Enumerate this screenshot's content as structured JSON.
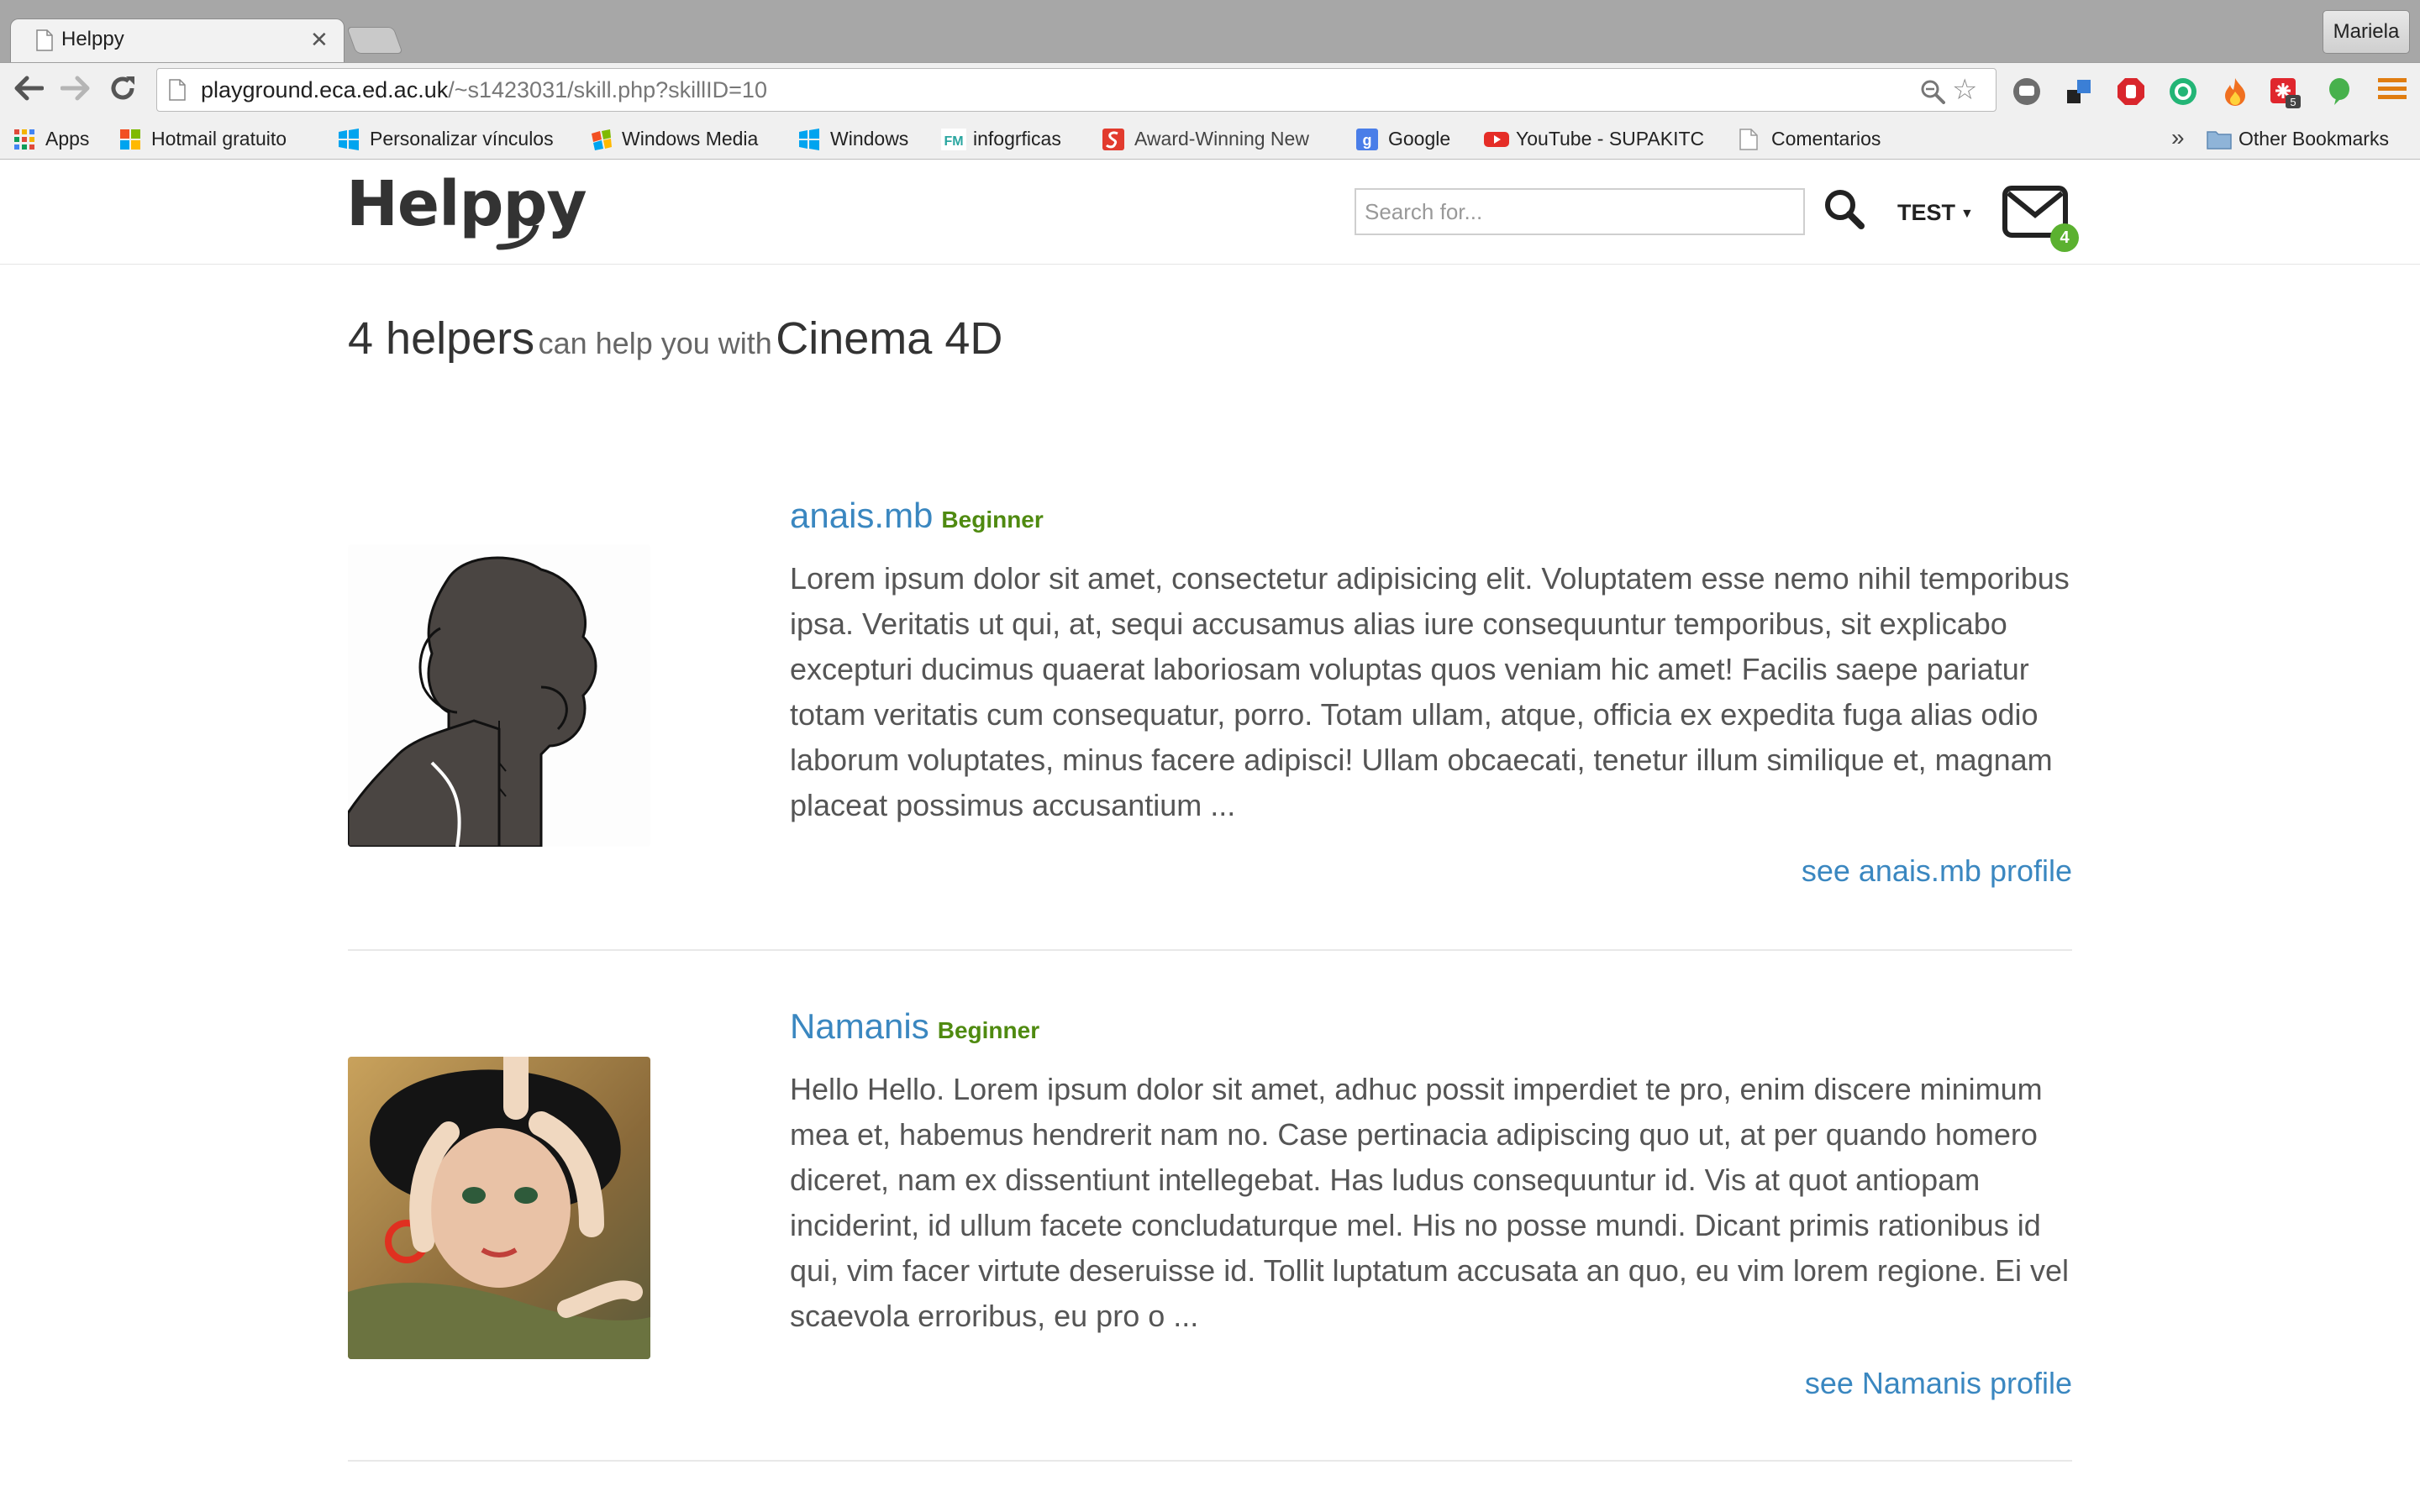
{
  "browser": {
    "tab_title": "Helppy",
    "profile_name": "Mariela",
    "url_host": "playground.eca.ed.ac.uk",
    "url_path": "/~s1423031/skill.php?skillID=10",
    "bookmarks": [
      {
        "label": "Apps",
        "icon": "apps-grid-icon",
        "color": "#e04a3a"
      },
      {
        "label": "Hotmail gratuito",
        "icon": "windows-logo-icon",
        "color": "#f25022"
      },
      {
        "label": "Personalizar vínculos",
        "icon": "windows-flag-icon",
        "color": "#00a4ef"
      },
      {
        "label": "Windows Media",
        "icon": "windows-media-icon",
        "color": "#7fba00"
      },
      {
        "label": "Windows",
        "icon": "windows-flag-icon",
        "color": "#00a4ef"
      },
      {
        "label": "infogrficas",
        "icon": "fm-icon",
        "color": "#2aa6a0"
      },
      {
        "label": "Award-Winning New",
        "icon": "award-icon",
        "color": "#e23b2e"
      },
      {
        "label": "Google",
        "icon": "google-icon",
        "color": "#4a7ee8"
      },
      {
        "label": "YouTube - SUPAKITC",
        "icon": "youtube-icon",
        "color": "#e52d27"
      },
      {
        "label": "Comentarios",
        "icon": "page-icon",
        "color": "#ffffff"
      }
    ],
    "other_bookmarks": "Other Bookmarks"
  },
  "site": {
    "logo": "Helppy",
    "search_placeholder": "Search for...",
    "user_menu": "TEST",
    "mail_count": "4"
  },
  "headline": {
    "count": "4 helpers",
    "middle": "can help you with",
    "skill": "Cinema 4D"
  },
  "helpers": [
    {
      "name": "anais.mb",
      "level": "Beginner",
      "bio": "Lorem ipsum dolor sit amet, consectetur adipisicing elit. Voluptatem esse nemo nihil temporibus ipsa. Veritatis ut qui, at, sequi accusamus alias iure consequuntur temporibus, sit explicabo excepturi ducimus quaerat laboriosam voluptas quos veniam hic amet! Facilis saepe pariatur totam veritatis cum consequatur, porro. Totam ullam, atque, officia ex expedita fuga alias odio laborum voluptates, minus facere adipisci! Ullam obcaecati, tenetur illum similique et, magnam placeat possimus accusantium ...",
      "link": "see anais.mb profile"
    },
    {
      "name": "Namanis",
      "level": "Beginner",
      "bio": "Hello Hello. Lorem ipsum dolor sit amet, adhuc possit imperdiet te pro, enim discere minimum mea et, habemus hendrerit nam no. Case pertinacia adipiscing quo ut, at per quando homero diceret, nam ex dissentiunt intellegebat. Has ludus consequuntur id. Vis at quot antiopam inciderint, id ullum facete concludaturque mel. His no posse mundi. Dicant primis rationibus id qui, vim facer virtute deseruisse id. Tollit luptatum accusata an quo, eu vim lorem regione. Ei vel scaevola erroribus, eu pro o ...",
      "link": "see Namanis profile"
    }
  ]
}
